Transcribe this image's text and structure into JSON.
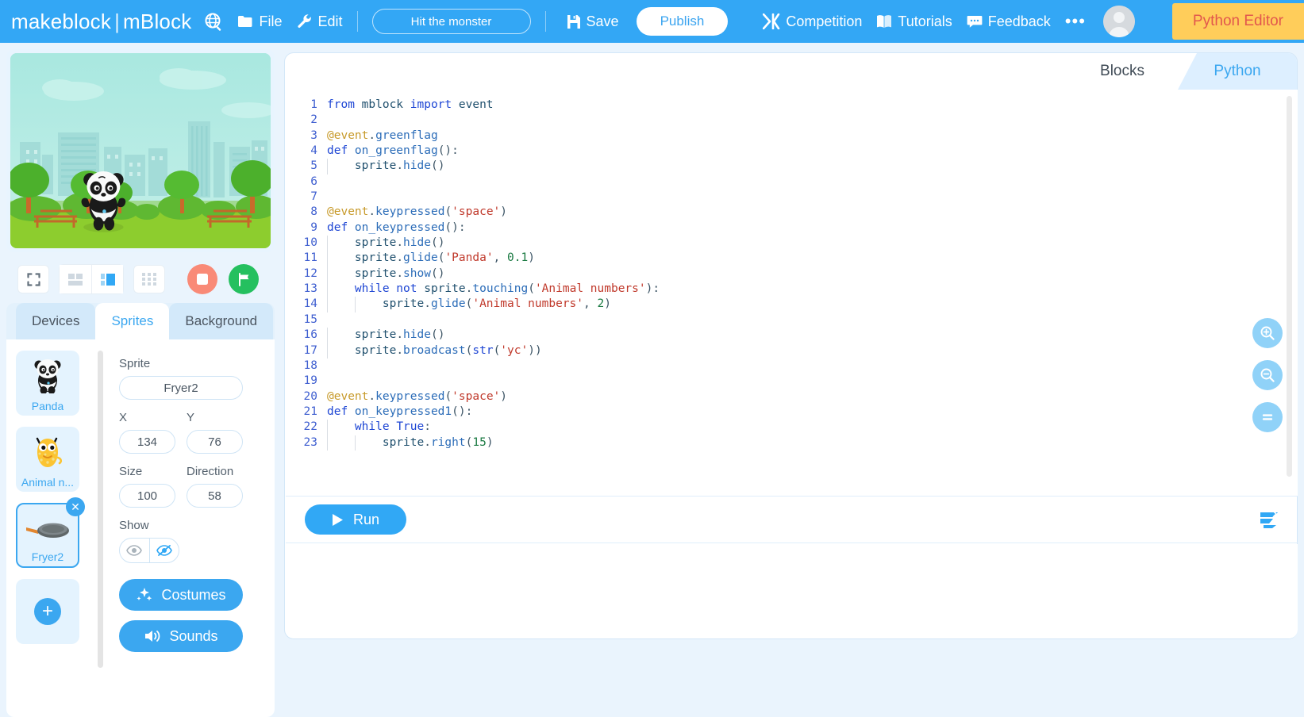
{
  "topbar": {
    "logo_make": "makeblock",
    "logo_sep": "|",
    "logo_mblock": "mBlock",
    "globe_icon": "globe-icon",
    "file_label": "File",
    "edit_label": "Edit",
    "project_name": "Hit the monster",
    "save_label": "Save",
    "publish_label": "Publish",
    "competition_label": "Competition",
    "tutorials_label": "Tutorials",
    "feedback_label": "Feedback",
    "more_label": "•••",
    "python_editor_label": "Python Editor",
    "bg_color": "#33a7f5",
    "python_editor_bg": "#ffcd5a",
    "python_editor_color": "#e2574d"
  },
  "stage": {
    "fullscreen_icon": "fullscreen-icon",
    "small_stage_icon": "small-stage-icon",
    "large_stage_icon": "large-stage-icon",
    "grid_icon": "grid-icon",
    "stop_icon": "stop-icon",
    "green_flag_icon": "green-flag-icon",
    "stop_color": "#f98a77",
    "flag_color": "#25c05f"
  },
  "panel": {
    "tabs": [
      {
        "label": "Devices",
        "active": false
      },
      {
        "label": "Sprites",
        "active": true
      },
      {
        "label": "Background",
        "active": false
      }
    ],
    "sprites": [
      {
        "name": "Panda",
        "selected": false,
        "icon": "panda-sprite-icon"
      },
      {
        "name": "Animal n...",
        "selected": false,
        "icon": "animal-numbers-sprite-icon"
      },
      {
        "name": "Fryer2",
        "selected": true,
        "icon": "fryer-sprite-icon",
        "deletable": true
      }
    ],
    "add_sprite_label": "+",
    "props": {
      "sprite_label": "Sprite",
      "sprite_value": "Fryer2",
      "x_label": "X",
      "x_value": "134",
      "y_label": "Y",
      "y_value": "76",
      "size_label": "Size",
      "size_value": "100",
      "direction_label": "Direction",
      "direction_value": "58",
      "show_label": "Show",
      "show_on_icon": "eye-icon",
      "show_off_icon": "eye-slash-icon",
      "costumes_label": "Costumes",
      "sounds_label": "Sounds"
    }
  },
  "editor": {
    "tab_blocks": "Blocks",
    "tab_python": "Python",
    "active_tab": "Python",
    "run_label": "Run",
    "zoom_in_icon": "zoom-in-icon",
    "zoom_out_icon": "zoom-out-icon",
    "zoom_reset_icon": "zoom-reset-icon",
    "console_icon": "console-toggle-icon",
    "code_lines": [
      {
        "n": 1,
        "tokens": [
          {
            "t": "from ",
            "c": "k"
          },
          {
            "t": "mblock ",
            "c": "ltext"
          },
          {
            "t": "import ",
            "c": "k"
          },
          {
            "t": "event",
            "c": "ltext"
          }
        ]
      },
      {
        "n": 2,
        "tokens": []
      },
      {
        "n": 3,
        "tokens": [
          {
            "t": "@event",
            "c": "dec"
          },
          {
            "t": ".",
            "c": "pn"
          },
          {
            "t": "greenflag",
            "c": "fn"
          }
        ]
      },
      {
        "n": 4,
        "tokens": [
          {
            "t": "def ",
            "c": "k"
          },
          {
            "t": "on_greenflag",
            "c": "fn"
          },
          {
            "t": "():",
            "c": "pn"
          }
        ]
      },
      {
        "n": 5,
        "tokens": [
          {
            "t": "    sprite",
            "c": "ltext"
          },
          {
            "t": ".",
            "c": "pn"
          },
          {
            "t": "hide",
            "c": "fn"
          },
          {
            "t": "()",
            "c": "pn"
          }
        ]
      },
      {
        "n": 6,
        "tokens": []
      },
      {
        "n": 7,
        "tokens": []
      },
      {
        "n": 8,
        "tokens": [
          {
            "t": "@event",
            "c": "dec"
          },
          {
            "t": ".",
            "c": "pn"
          },
          {
            "t": "keypressed",
            "c": "fn"
          },
          {
            "t": "(",
            "c": "pn"
          },
          {
            "t": "'space'",
            "c": "st"
          },
          {
            "t": ")",
            "c": "pn"
          }
        ]
      },
      {
        "n": 9,
        "tokens": [
          {
            "t": "def ",
            "c": "k"
          },
          {
            "t": "on_keypressed",
            "c": "fn"
          },
          {
            "t": "():",
            "c": "pn"
          }
        ]
      },
      {
        "n": 10,
        "tokens": [
          {
            "t": "    sprite",
            "c": "ltext"
          },
          {
            "t": ".",
            "c": "pn"
          },
          {
            "t": "hide",
            "c": "fn"
          },
          {
            "t": "()",
            "c": "pn"
          }
        ]
      },
      {
        "n": 11,
        "tokens": [
          {
            "t": "    sprite",
            "c": "ltext"
          },
          {
            "t": ".",
            "c": "pn"
          },
          {
            "t": "glide",
            "c": "fn"
          },
          {
            "t": "(",
            "c": "pn"
          },
          {
            "t": "'Panda'",
            "c": "st"
          },
          {
            "t": ", ",
            "c": "pn"
          },
          {
            "t": "0.1",
            "c": "num"
          },
          {
            "t": ")",
            "c": "pn"
          }
        ]
      },
      {
        "n": 12,
        "tokens": [
          {
            "t": "    sprite",
            "c": "ltext"
          },
          {
            "t": ".",
            "c": "pn"
          },
          {
            "t": "show",
            "c": "fn"
          },
          {
            "t": "()",
            "c": "pn"
          }
        ]
      },
      {
        "n": 13,
        "tokens": [
          {
            "t": "    ",
            "c": "ltext"
          },
          {
            "t": "while not ",
            "c": "k"
          },
          {
            "t": "sprite",
            "c": "ltext"
          },
          {
            "t": ".",
            "c": "pn"
          },
          {
            "t": "touching",
            "c": "fn"
          },
          {
            "t": "(",
            "c": "pn"
          },
          {
            "t": "'Animal numbers'",
            "c": "st"
          },
          {
            "t": "):",
            "c": "pn"
          }
        ]
      },
      {
        "n": 14,
        "tokens": [
          {
            "t": "        sprite",
            "c": "ltext"
          },
          {
            "t": ".",
            "c": "pn"
          },
          {
            "t": "glide",
            "c": "fn"
          },
          {
            "t": "(",
            "c": "pn"
          },
          {
            "t": "'Animal numbers'",
            "c": "st"
          },
          {
            "t": ", ",
            "c": "pn"
          },
          {
            "t": "2",
            "c": "num"
          },
          {
            "t": ")",
            "c": "pn"
          }
        ]
      },
      {
        "n": 15,
        "tokens": []
      },
      {
        "n": 16,
        "tokens": [
          {
            "t": "    sprite",
            "c": "ltext"
          },
          {
            "t": ".",
            "c": "pn"
          },
          {
            "t": "hide",
            "c": "fn"
          },
          {
            "t": "()",
            "c": "pn"
          }
        ]
      },
      {
        "n": 17,
        "tokens": [
          {
            "t": "    sprite",
            "c": "ltext"
          },
          {
            "t": ".",
            "c": "pn"
          },
          {
            "t": "broadcast",
            "c": "fn"
          },
          {
            "t": "(",
            "c": "pn"
          },
          {
            "t": "str",
            "c": "k"
          },
          {
            "t": "(",
            "c": "pn"
          },
          {
            "t": "'yc'",
            "c": "st"
          },
          {
            "t": "))",
            "c": "pn"
          }
        ]
      },
      {
        "n": 18,
        "tokens": []
      },
      {
        "n": 19,
        "tokens": []
      },
      {
        "n": 20,
        "tokens": [
          {
            "t": "@event",
            "c": "dec"
          },
          {
            "t": ".",
            "c": "pn"
          },
          {
            "t": "keypressed",
            "c": "fn"
          },
          {
            "t": "(",
            "c": "pn"
          },
          {
            "t": "'space'",
            "c": "st"
          },
          {
            "t": ")",
            "c": "pn"
          }
        ]
      },
      {
        "n": 21,
        "tokens": [
          {
            "t": "def ",
            "c": "k"
          },
          {
            "t": "on_keypressed1",
            "c": "fn"
          },
          {
            "t": "():",
            "c": "pn"
          }
        ]
      },
      {
        "n": 22,
        "tokens": [
          {
            "t": "    ",
            "c": "ltext"
          },
          {
            "t": "while ",
            "c": "k"
          },
          {
            "t": "True",
            "c": "k"
          },
          {
            "t": ":",
            "c": "pn"
          }
        ]
      },
      {
        "n": 23,
        "tokens": [
          {
            "t": "        sprite",
            "c": "ltext"
          },
          {
            "t": ".",
            "c": "pn"
          },
          {
            "t": "right",
            "c": "fn"
          },
          {
            "t": "(",
            "c": "pn"
          },
          {
            "t": "15",
            "c": "num"
          },
          {
            "t": ")",
            "c": "pn"
          }
        ]
      }
    ]
  }
}
